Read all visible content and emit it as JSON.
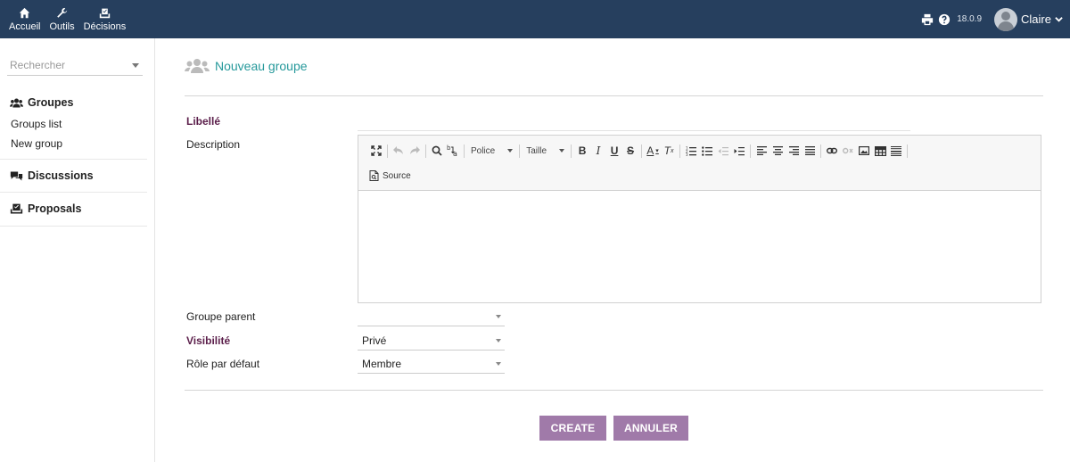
{
  "topbar": {
    "nav": [
      {
        "label": "Accueil",
        "icon": "home-icon"
      },
      {
        "label": "Outils",
        "icon": "wrench-icon"
      },
      {
        "label": "Décisions",
        "icon": "ballot-box-icon"
      }
    ],
    "version": "18.0.9",
    "user": "Claire"
  },
  "sidebar": {
    "search_placeholder": "Rechercher",
    "groups_title": "Groupes",
    "groups_items": [
      "Groups list",
      "New group"
    ],
    "discussions_title": "Discussions",
    "proposals_title": "Proposals"
  },
  "form": {
    "title": "Nouveau groupe",
    "labels": {
      "libelle": "Libellé",
      "description": "Description",
      "parent": "Groupe parent",
      "visibilite": "Visibilité",
      "role": "Rôle par défaut"
    },
    "values": {
      "parent": "",
      "visibilite": "Privé",
      "role": "Membre"
    },
    "editor": {
      "font_label": "Police",
      "size_label": "Taille",
      "source_label": "Source"
    },
    "create_label": "CREATE",
    "cancel_label": "ANNULER"
  },
  "colors": {
    "topbar": "#263f5e",
    "accent": "#26999b",
    "required_label": "#5b1e4a",
    "button": "#a07aa9"
  }
}
